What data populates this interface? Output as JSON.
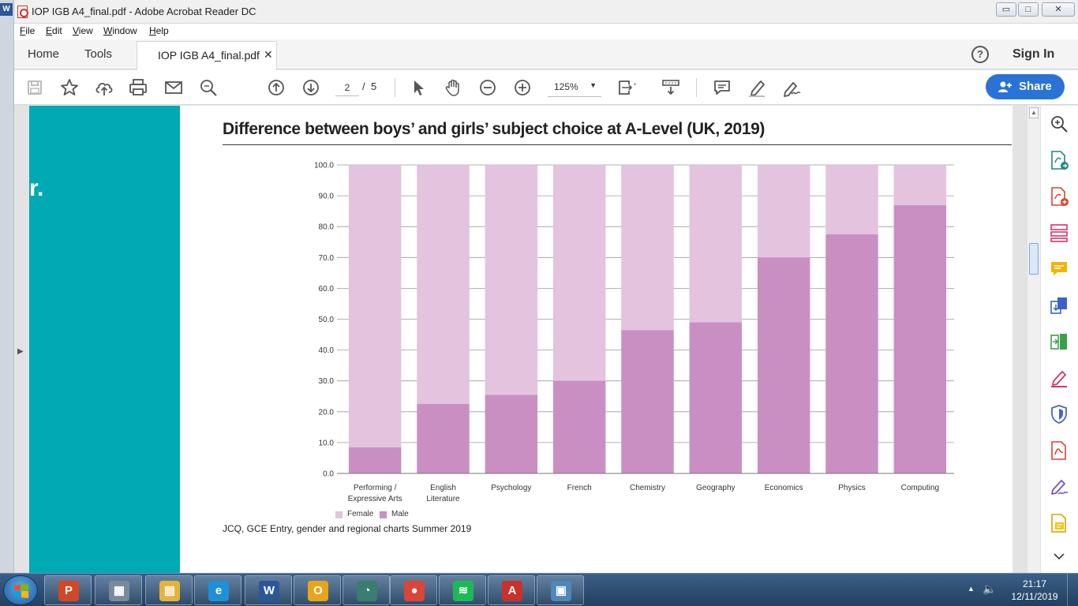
{
  "window": {
    "title": "IOP IGB A4_final.pdf - Adobe Acrobat Reader DC",
    "minimize_glyph": "▭",
    "maximize_glyph": "□",
    "close_glyph": "✕"
  },
  "left_strip": {
    "app_letter": "W"
  },
  "menu": [
    "File",
    "Edit",
    "View",
    "Window",
    "Help"
  ],
  "tabs": {
    "home": "Home",
    "tools": "Tools",
    "document": "IOP IGB A4_final.pdf",
    "close_glyph": "✕"
  },
  "header_right": {
    "help_glyph": "?",
    "sign_in": "Sign In"
  },
  "toolbar": {
    "icons": [
      "save-icon",
      "bookmark-star-icon",
      "cloud-upload-icon",
      "print-icon",
      "email-icon",
      "find-zoom-icon",
      "page-up-icon",
      "page-down-icon",
      "select-cursor-icon",
      "hand-tool-icon",
      "zoom-out-icon",
      "zoom-in-icon",
      "fit-page-icon",
      "scroll-mode-icon",
      "comment-icon",
      "highlight-pen-icon",
      "sign-icon"
    ],
    "page_current": "2",
    "page_separator": "/",
    "page_total": "5",
    "zoom": "125%",
    "zoom_caret": "▼",
    "share_label": "Share"
  },
  "page": {
    "band_text": "r.",
    "title": "Difference between boys’ and girls’ subject choice at A-Level (UK, 2019)",
    "source": "JCQ, GCE Entry, gender and regional charts Summer 2019",
    "band_color": "#00a9b3"
  },
  "panel_toggles": {
    "left": "▶",
    "right": "◀",
    "scroll_up": "▲"
  },
  "chart_data": {
    "type": "bar",
    "stacked": true,
    "categories": [
      "Performing / Expressive Arts",
      "English Literature",
      "Psychology",
      "French",
      "Chemistry",
      "Geography",
      "Economics",
      "Physics",
      "Computing"
    ],
    "category_lines": [
      [
        "Performing /",
        "Expressive Arts"
      ],
      [
        "English",
        "Literature"
      ],
      [
        "Psychology"
      ],
      [
        "French"
      ],
      [
        "Chemistry"
      ],
      [
        "Geography"
      ],
      [
        "Economics"
      ],
      [
        "Physics"
      ],
      [
        "Computing"
      ]
    ],
    "series": [
      {
        "name": "Male",
        "color": "#c98fc2",
        "values": [
          8.5,
          22.5,
          25.5,
          30.0,
          46.5,
          49.0,
          70.0,
          77.5,
          87.0
        ]
      },
      {
        "name": "Female",
        "color": "#e3c3de",
        "values": [
          91.5,
          77.5,
          74.5,
          70.0,
          53.5,
          51.0,
          30.0,
          22.5,
          13.0
        ]
      }
    ],
    "legend": [
      {
        "name": "Female",
        "color": "#e3c3de"
      },
      {
        "name": "Male",
        "color": "#c98fc2"
      }
    ],
    "yticks": [
      "100.0",
      "90.0",
      "80.0",
      "70.0",
      "60.0",
      "50.0",
      "40.0",
      "30.0",
      "20.0",
      "10.0",
      "0.0"
    ],
    "ylim": [
      0,
      100
    ],
    "grid": true,
    "legend_position": "bottom-left"
  },
  "right_pane": {
    "icons": [
      "enhance-scan-icon",
      "export-pdf-icon",
      "create-pdf-icon",
      "organize-pages-icon",
      "comment-tool-icon",
      "combine-files-icon",
      "compress-pdf-icon",
      "fill-sign-icon",
      "protect-icon",
      "pdf-icon",
      "sign-pen-icon",
      "document-note-icon",
      "more-tools-chevron-icon"
    ]
  },
  "taskbar": {
    "apps": [
      {
        "name": "powerpoint",
        "glyph": "P",
        "color": "#d24726"
      },
      {
        "name": "calculator",
        "glyph": "▦",
        "color": "#7a8a9a"
      },
      {
        "name": "file-explorer",
        "glyph": "▤",
        "color": "#e3b43c"
      },
      {
        "name": "internet-explorer",
        "glyph": "e",
        "color": "#1e90d8"
      },
      {
        "name": "word",
        "glyph": "W",
        "color": "#2b5797"
      },
      {
        "name": "outlook",
        "glyph": "O",
        "color": "#e8a51a"
      },
      {
        "name": "network-app",
        "glyph": "◔",
        "color": "#3b7d6e"
      },
      {
        "name": "chrome",
        "glyph": "●",
        "color": "#db4437"
      },
      {
        "name": "spotify",
        "glyph": "≋",
        "color": "#1db954"
      },
      {
        "name": "acrobat",
        "glyph": "A",
        "color": "#c8322b"
      },
      {
        "name": "photo-viewer",
        "glyph": "▣",
        "color": "#4f87b8"
      }
    ],
    "tray_up_glyph": "▲",
    "volume_glyph": "🔈",
    "time": "21:17",
    "date": "12/11/2019"
  }
}
